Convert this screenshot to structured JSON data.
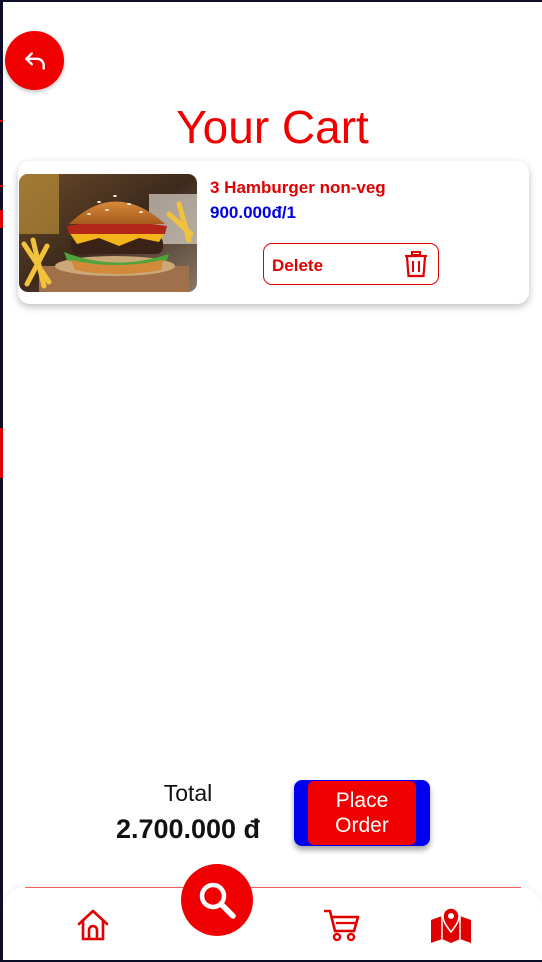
{
  "page": {
    "title": "Your Cart"
  },
  "cart": {
    "items": [
      {
        "name": "3 Hamburger non-veg",
        "price": "900.000đ/1",
        "delete_label": "Delete",
        "image": "hamburger-photo"
      }
    ]
  },
  "summary": {
    "total_label": "Total",
    "total_value": "2.700.000 đ",
    "place_order_label": "Place\nOrder"
  },
  "icons": {
    "back": "back-arrow-icon",
    "trash": "trash-icon",
    "home": "home-icon",
    "search": "search-icon",
    "cart": "cart-icon",
    "map": "map-icon"
  },
  "colors": {
    "accent": "#f00000",
    "price": "#0000e0",
    "order_outer": "#0000f0",
    "background": "#ffffff"
  }
}
